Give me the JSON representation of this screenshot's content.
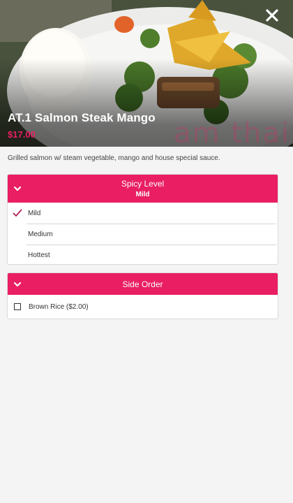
{
  "item": {
    "name": "AT.1 Salmon Steak Mango",
    "price": "$17.00",
    "description": "Grilled salmon w/ steam vegetable, mango and house special sauce.",
    "watermark": "am thai"
  },
  "spicy_level": {
    "title": "Spicy Level",
    "selected": "Mild",
    "options": [
      {
        "label": "Mild",
        "checked": true
      },
      {
        "label": "Medium",
        "checked": false
      },
      {
        "label": "Hottest",
        "checked": false
      }
    ]
  },
  "side_order": {
    "title": "Side Order",
    "options": [
      {
        "label": "Brown Rice ($2.00)",
        "checked": false
      }
    ]
  },
  "icons": {
    "close": "close-icon",
    "collapse": "chevron-down-icon",
    "selected": "checkmark-icon"
  },
  "colors": {
    "accent": "#e91e63",
    "background": "#f4f4f4"
  }
}
